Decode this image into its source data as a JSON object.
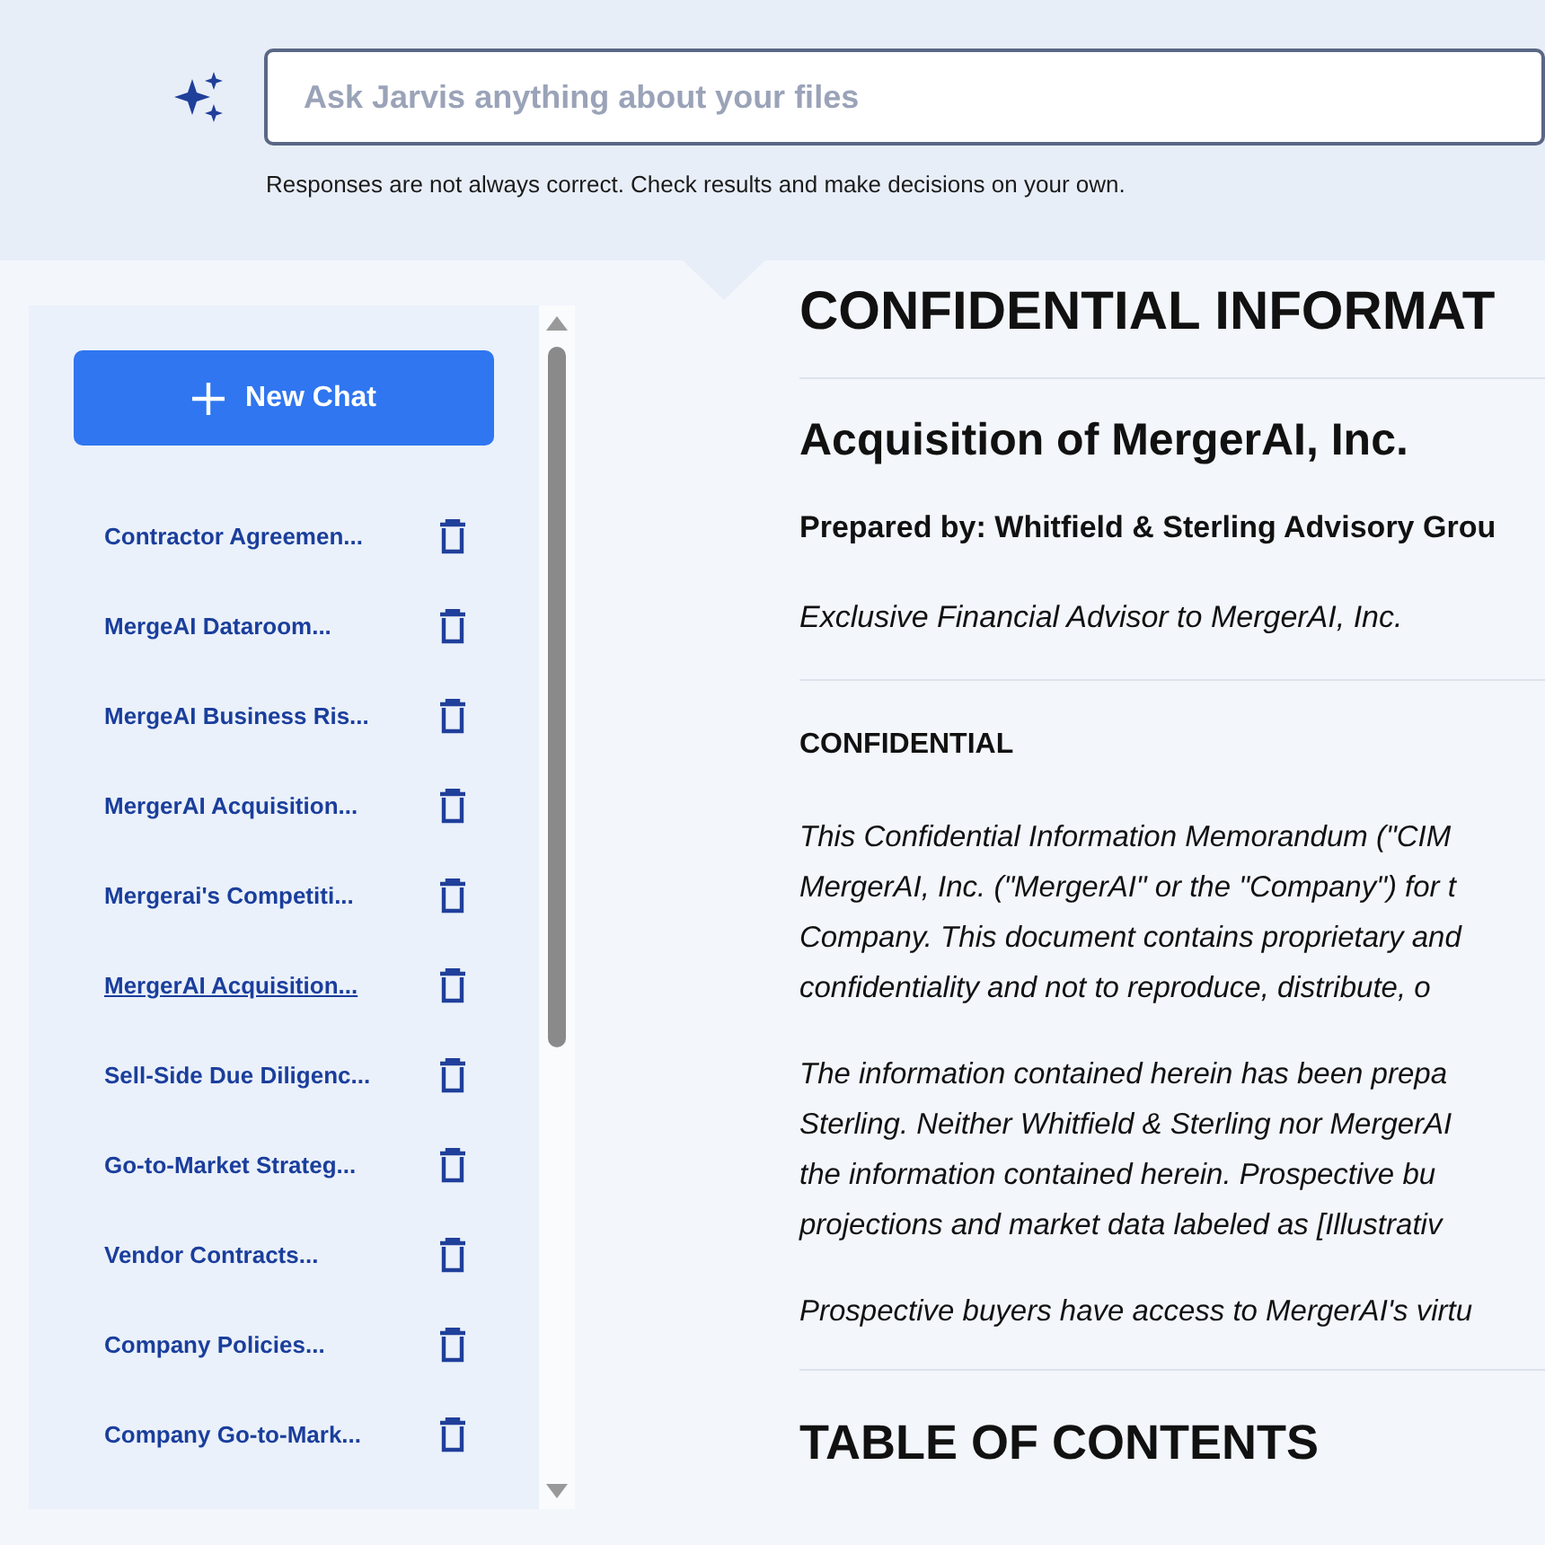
{
  "header": {
    "search": {
      "placeholder": "Ask Jarvis anything about your files"
    },
    "disclaimer": "Responses are not always correct. Check results and make decisions on your own."
  },
  "sidebar": {
    "new_chat_button": "New Chat",
    "chats": [
      {
        "title": "Contractor Agreemen...",
        "selected": false
      },
      {
        "title": "MergeAI Dataroom...",
        "selected": false
      },
      {
        "title": "MergeAI Business Ris...",
        "selected": false
      },
      {
        "title": "MergerAI Acquisition...",
        "selected": false
      },
      {
        "title": "Mergerai's Competiti...",
        "selected": false
      },
      {
        "title": "MergerAI Acquisition...",
        "selected": true
      },
      {
        "title": "Sell-Side Due Diligenc...",
        "selected": false
      },
      {
        "title": "Go-to-Market Strateg...",
        "selected": false
      },
      {
        "title": "Vendor Contracts...",
        "selected": false
      },
      {
        "title": "Company Policies...",
        "selected": false
      },
      {
        "title": "Company Go-to-Mark...",
        "selected": false
      }
    ]
  },
  "document": {
    "title": "CONFIDENTIAL INFORMAT",
    "subtitle": "Acquisition of MergerAI, Inc.",
    "prepared_by": "Prepared by: Whitfield & Sterling Advisory Grou",
    "advisor": "Exclusive Financial Advisor to MergerAI, Inc.",
    "section_heading": "CONFIDENTIAL",
    "paragraphs": [
      [
        "This Confidential Information Memorandum (\"CIM",
        "MergerAI, Inc. (\"MergerAI\" or the \"Company\") for t",
        "Company. This document contains proprietary and",
        "confidentiality and not to reproduce, distribute, o"
      ],
      [
        "The information contained herein has been prepa",
        "Sterling. Neither Whitfield & Sterling nor MergerAI",
        "the information contained herein. Prospective bu",
        "projections and market data labeled as [Illustrativ"
      ],
      [
        "Prospective buyers have access to MergerAI's virtu"
      ]
    ],
    "toc_heading": "TABLE OF CONTENTS"
  }
}
